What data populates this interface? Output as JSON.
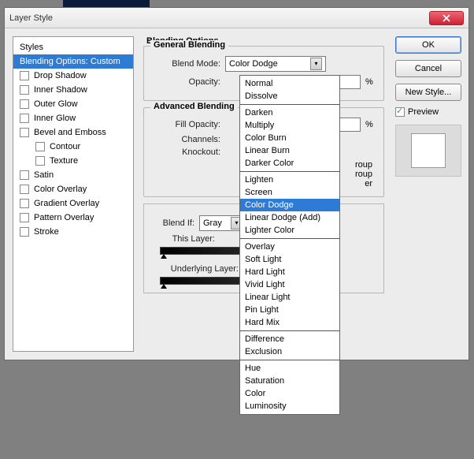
{
  "dialog": {
    "title": "Layer Style"
  },
  "styles_panel": {
    "header": "Styles",
    "selected": "Blending Options: Custom",
    "items": [
      {
        "label": "Drop Shadow"
      },
      {
        "label": "Inner Shadow"
      },
      {
        "label": "Outer Glow"
      },
      {
        "label": "Inner Glow"
      },
      {
        "label": "Bevel and Emboss"
      },
      {
        "label": "Contour",
        "indent": true
      },
      {
        "label": "Texture",
        "indent": true
      },
      {
        "label": "Satin"
      },
      {
        "label": "Color Overlay"
      },
      {
        "label": "Gradient Overlay"
      },
      {
        "label": "Pattern Overlay"
      },
      {
        "label": "Stroke"
      }
    ]
  },
  "blending": {
    "section_title": "Blending Options",
    "general_title": "General Blending",
    "blend_mode_label": "Blend Mode:",
    "blend_mode_value": "Color Dodge",
    "opacity_label": "Opacity:",
    "opacity_value": "",
    "percent": "%",
    "advanced_title": "Advanced Blending",
    "fill_opacity_label": "Fill Opacity:",
    "channels_label": "Channels:",
    "knockout_label": "Knockout:",
    "obscured": {
      "a": "roup",
      "b": "roup",
      "c": "er"
    },
    "blendif_label": "Blend If:",
    "blendif_value": "Gray",
    "this_layer_label": "This Layer:",
    "underlying_label": "Underlying Layer:"
  },
  "dropdown": {
    "groups": [
      [
        "Normal",
        "Dissolve"
      ],
      [
        "Darken",
        "Multiply",
        "Color Burn",
        "Linear Burn",
        "Darker Color"
      ],
      [
        "Lighten",
        "Screen",
        "Color Dodge",
        "Linear Dodge (Add)",
        "Lighter Color"
      ],
      [
        "Overlay",
        "Soft Light",
        "Hard Light",
        "Vivid Light",
        "Linear Light",
        "Pin Light",
        "Hard Mix"
      ],
      [
        "Difference",
        "Exclusion"
      ],
      [
        "Hue",
        "Saturation",
        "Color",
        "Luminosity"
      ]
    ],
    "highlighted": "Color Dodge"
  },
  "buttons": {
    "ok": "OK",
    "cancel": "Cancel",
    "new_style": "New Style...",
    "preview": "Preview"
  }
}
